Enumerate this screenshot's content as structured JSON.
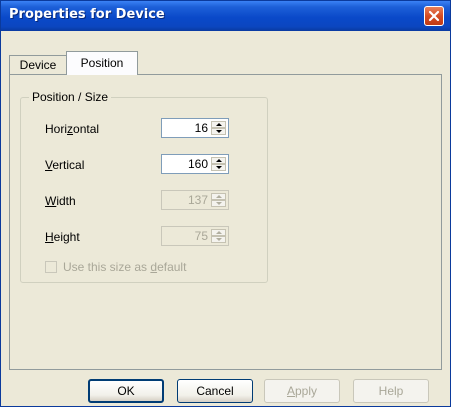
{
  "window": {
    "title": "Properties for Device"
  },
  "tabs": [
    {
      "label": "Device"
    },
    {
      "label": "Position"
    }
  ],
  "group": {
    "title": "Position / Size"
  },
  "fields": {
    "horizontal": {
      "label_pre": "Hori",
      "label_accel": "z",
      "label_post": "ontal",
      "value": "16"
    },
    "vertical": {
      "label_pre": "",
      "label_accel": "V",
      "label_post": "ertical",
      "value": "160"
    },
    "width": {
      "label_pre": "",
      "label_accel": "W",
      "label_post": "idth",
      "value": "137"
    },
    "height": {
      "label_pre": "",
      "label_accel": "H",
      "label_post": "eight",
      "value": "75"
    }
  },
  "checkbox": {
    "label_pre": "Use this size as ",
    "label_accel": "d",
    "label_post": "efault",
    "checked": false
  },
  "buttons": {
    "ok": "OK",
    "cancel": "Cancel",
    "apply_pre": "",
    "apply_accel": "A",
    "apply_post": "pply",
    "help": "Help"
  },
  "colors": {
    "titlebar": "#0a49c9",
    "face": "#ece9d8",
    "disabled_text": "#a9a798",
    "close": "#d44c24"
  }
}
